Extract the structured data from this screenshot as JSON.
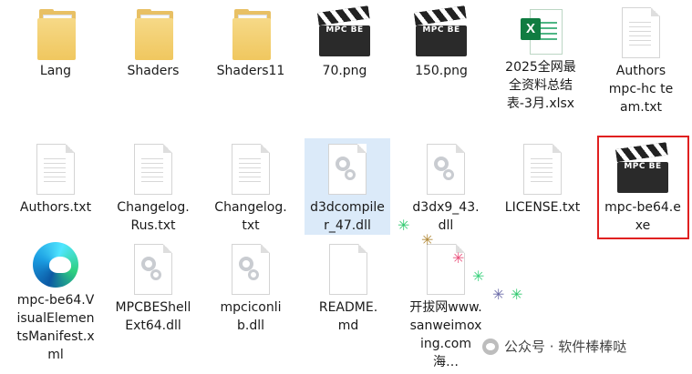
{
  "files": {
    "lang": "Lang",
    "shaders": "Shaders",
    "shaders11": "Shaders11",
    "png70": "70.png",
    "png150": "150.png",
    "xlsx": "2025全网最全资料总结表-3月.xlsx",
    "authors_mpc": "Authors mpc-hc team.txt",
    "authors_txt": "Authors.txt",
    "changelog_rus": "Changelog.Rus.txt",
    "changelog": "Changelog.txt",
    "d3dcompiler": "d3dcompiler_47.dll",
    "d3dx9": "d3dx9_43.dll",
    "license": "LICENSE.txt",
    "mpc_exe": "mpc-be64.exe",
    "manifest": "mpc-be64.VisualElementsManifest.xml",
    "shellext": "MPCBEShellExt64.dll",
    "iconlib": "mpciconlib.dll",
    "readme": "README.md",
    "kaiba": "开拔网www.sanweimoxing.com 海…"
  },
  "clap_text": "MPC BE",
  "excel_letter": "X",
  "watermark": "公众号 · 软件棒棒哒",
  "colors": {
    "highlight": "#dbeaf9",
    "red_frame": "#e02020",
    "folder": "#f0c75f"
  }
}
